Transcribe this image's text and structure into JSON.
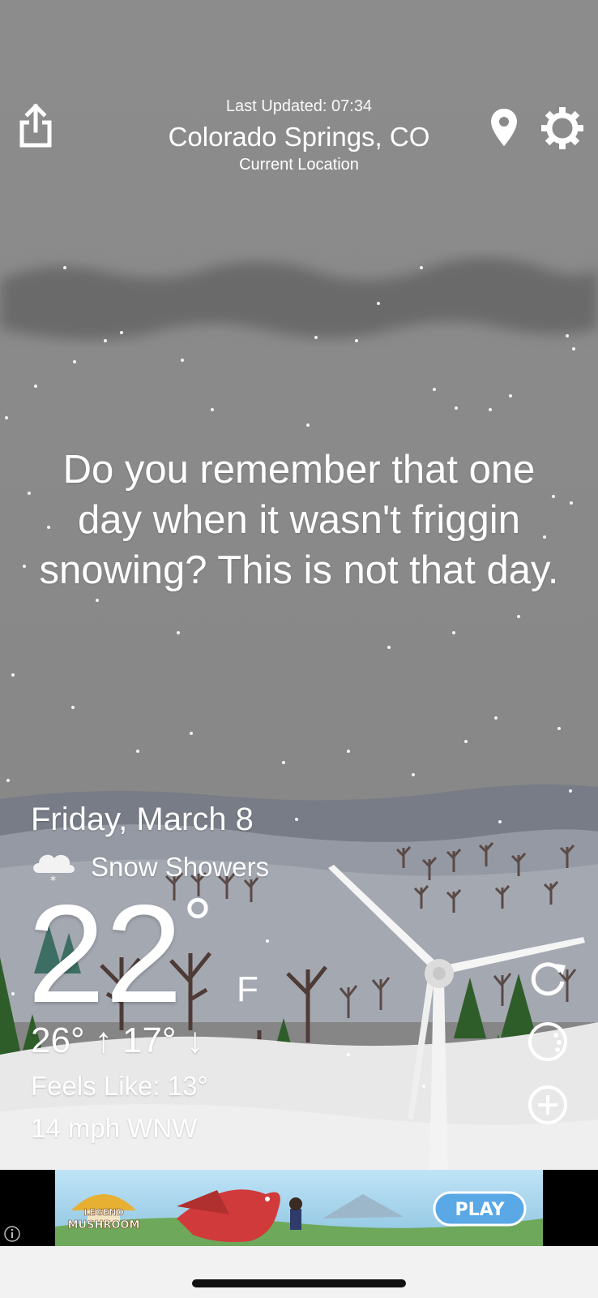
{
  "header": {
    "last_updated": "Last Updated: 07:34",
    "location": "Colorado Springs, CO",
    "location_sub": "Current Location"
  },
  "message": "Do you remember that one day when it wasn't friggin snowing? This is not that day.",
  "weather": {
    "date": "Friday, March 8",
    "condition": "Snow Showers",
    "temperature": "22",
    "degree_symbol": "°",
    "unit": "F",
    "hi_lo": "26° ↑ 17° ↓",
    "feels_like": "Feels Like: 13°",
    "wind": "14 mph WNW"
  },
  "ad": {
    "logo_text_top": "LEGEND",
    "logo_text_bottom": "MUSHROOM",
    "cta": "PLAY"
  },
  "icons": {
    "share": "share-icon",
    "location": "location-pin-icon",
    "settings": "gear-icon",
    "refresh": "refresh-icon",
    "theme": "theme-toggle-icon",
    "add": "add-icon",
    "condition": "snow-cloud-icon",
    "ad_info": "info-icon"
  },
  "colors": {
    "sky": "#8a8a8a",
    "snow_ground": "#e8e8e8",
    "tree_green": "#2f5d2a",
    "ad_cta": "#5aa8e6"
  }
}
